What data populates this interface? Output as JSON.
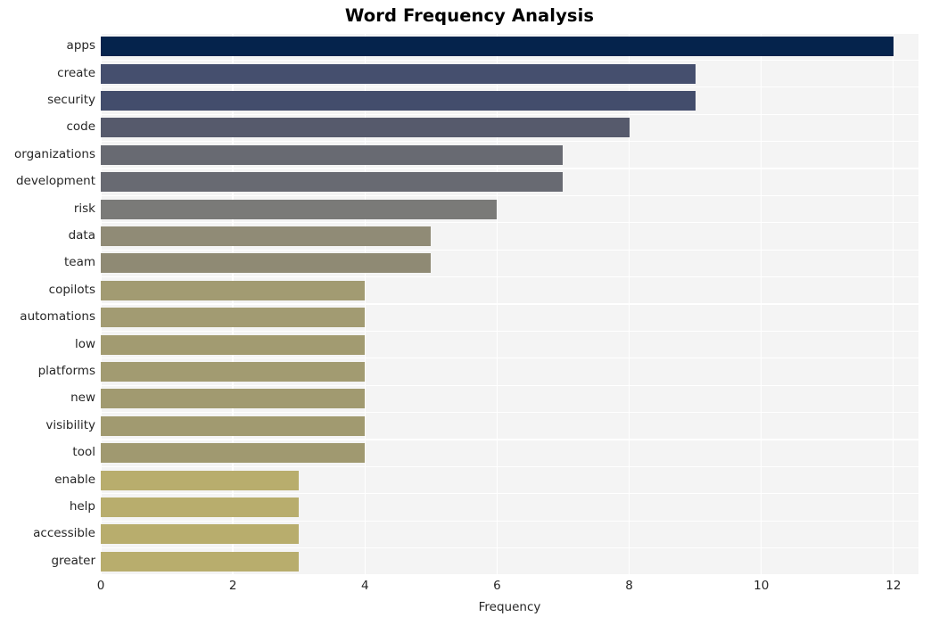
{
  "chart_data": {
    "type": "bar",
    "orientation": "horizontal",
    "title": "Word Frequency Analysis",
    "xlabel": "Frequency",
    "ylabel": "",
    "categories": [
      "apps",
      "create",
      "security",
      "code",
      "organizations",
      "development",
      "risk",
      "data",
      "team",
      "copilots",
      "automations",
      "low",
      "platforms",
      "new",
      "visibility",
      "tool",
      "enable",
      "help",
      "accessible",
      "greater"
    ],
    "values": [
      12,
      9,
      9,
      8,
      7,
      7,
      6,
      5,
      5,
      4,
      4,
      4,
      4,
      4,
      4,
      4,
      3,
      3,
      3,
      3
    ],
    "bar_colors": [
      "#05234c",
      "#454f6e",
      "#434d6c",
      "#565a6c",
      "#686a72",
      "#686a72",
      "#7a7a78",
      "#908b76",
      "#8f8a74",
      "#a29b72",
      "#a29b72",
      "#a29b71",
      "#a29b71",
      "#a19a70",
      "#a19a70",
      "#a09970",
      "#b8ad6d",
      "#b8ad6d",
      "#b8ad6d",
      "#b8ad6d"
    ],
    "xlim": [
      0,
      12.38
    ],
    "xticks": [
      0,
      2,
      4,
      6,
      8,
      10,
      12
    ],
    "xtick_labels": [
      "0",
      "2",
      "4",
      "6",
      "8",
      "10",
      "12"
    ],
    "grid": true,
    "grid_color": "#ffffff",
    "plot_background": "#f4f4f4",
    "figure_background": "#ffffff",
    "legend": null
  }
}
